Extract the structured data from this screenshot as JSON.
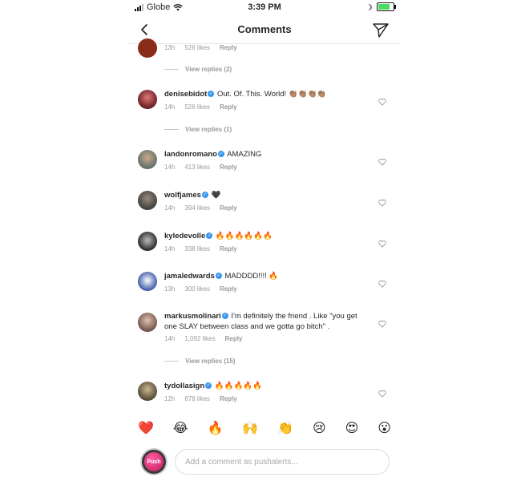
{
  "status": {
    "carrier": "Globe",
    "time": "3:39 PM"
  },
  "nav": {
    "title": "Comments"
  },
  "comments": [
    {
      "user": "",
      "text": "",
      "age": "13h",
      "likes": "526 likes",
      "reply": "Reply"
    },
    {
      "user": "denisebidot",
      "text": "Out. Of. This. World! 👏🏽👏🏽👏🏽👏🏽",
      "age": "14h",
      "likes": "526 likes",
      "reply": "Reply"
    },
    {
      "user": "landonromano",
      "text": "AMAZING",
      "age": "14h",
      "likes": "413 likes",
      "reply": "Reply"
    },
    {
      "user": "wolfjames",
      "text": "🖤",
      "age": "14h",
      "likes": "394 likes",
      "reply": "Reply"
    },
    {
      "user": "kyledevolle",
      "text": "🔥🔥🔥🔥🔥🔥",
      "age": "14h",
      "likes": "338 likes",
      "reply": "Reply"
    },
    {
      "user": "jamaledwards",
      "text": "MADDDD!!!! 🔥",
      "age": "13h",
      "likes": "300 likes",
      "reply": "Reply"
    },
    {
      "user": "markusmolinari",
      "text": "I'm definitely the friend . Like \"you get one SLAY between class and we gotta go bitch\" .",
      "age": "14h",
      "likes": "1,092 likes",
      "reply": "Reply"
    },
    {
      "user": "tydollasign",
      "text": "🔥🔥🔥🔥🔥",
      "age": "12h",
      "likes": "678 likes",
      "reply": "Reply"
    }
  ],
  "view_replies": [
    "View replies (2)",
    "View replies (1)",
    "View replies (15)"
  ],
  "emoji_bar": [
    "❤️",
    "😂",
    "🔥",
    "🙌",
    "👏",
    "😢",
    "😍",
    "😮"
  ],
  "composer": {
    "placeholder": "Add a comment as pushalerts...",
    "avatar_text": "Push"
  },
  "colors": {
    "verified": "#3897f0",
    "meta": "#999999",
    "divider": "#e6e6e6"
  }
}
